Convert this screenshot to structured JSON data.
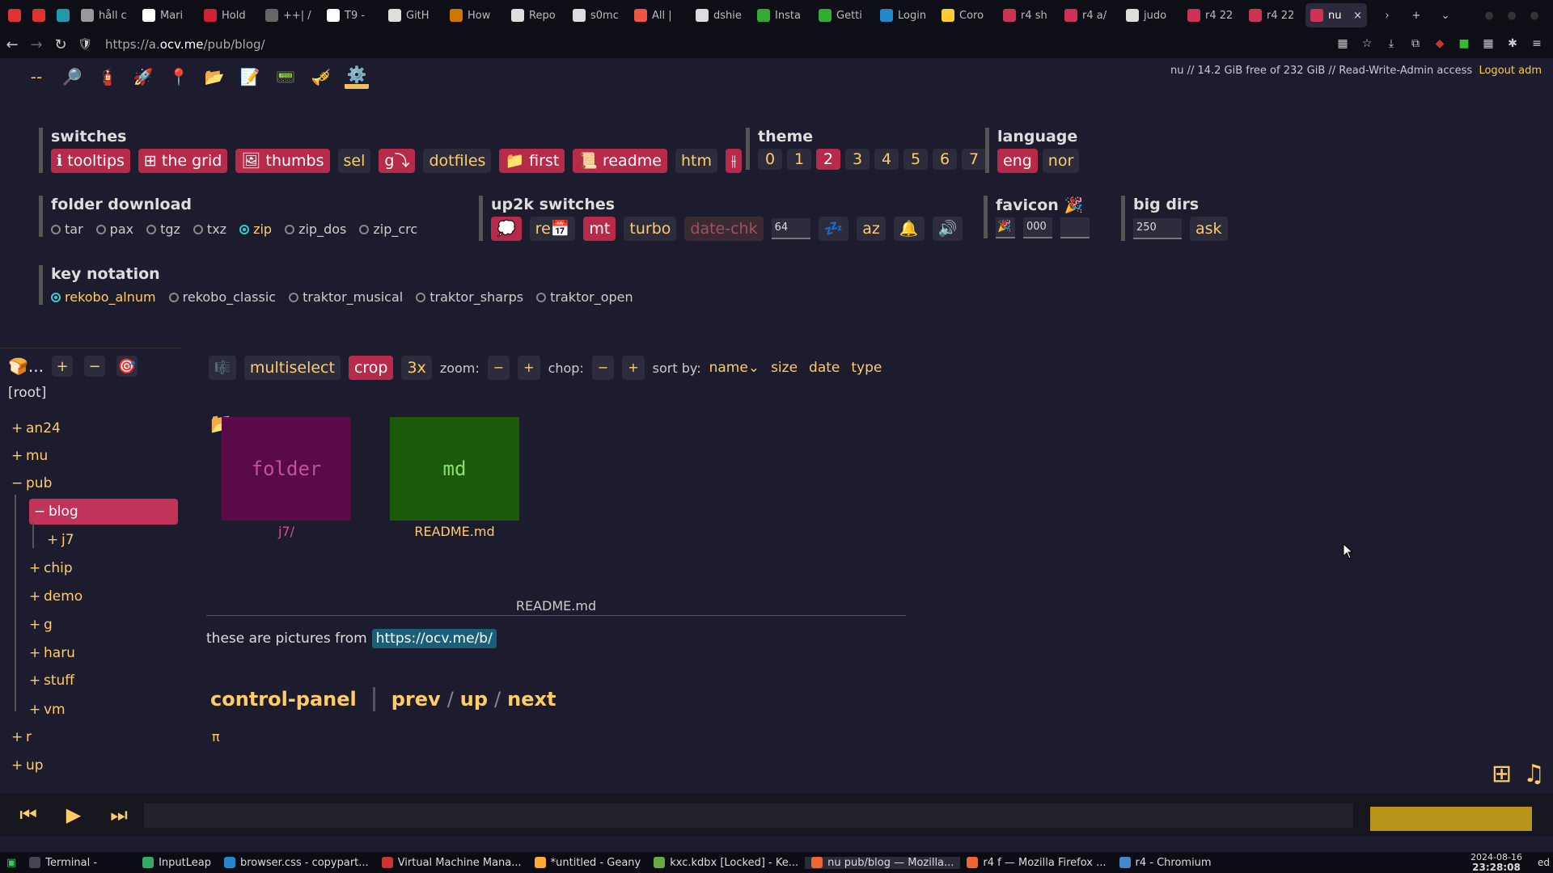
{
  "browser": {
    "tabs": [
      {
        "label": "",
        "icon": "opera-icon",
        "color": "#d33"
      },
      {
        "label": "",
        "icon": "opera-icon",
        "color": "#d33"
      },
      {
        "label": "",
        "icon": "telegram-icon",
        "color": "#29a"
      },
      {
        "label": "håll c",
        "icon": "back-chevron-icon",
        "color": "#999"
      },
      {
        "label": "Mari",
        "icon": "google-icon",
        "color": "#fff"
      },
      {
        "label": "Hold",
        "icon": "page-icon",
        "color": "#c23"
      },
      {
        "label": "++| /",
        "icon": "page-icon",
        "color": "#666"
      },
      {
        "label": "T9 -",
        "icon": "wikipedia-icon",
        "color": "#fff"
      },
      {
        "label": "GitH",
        "icon": "github-icon",
        "color": "#ddd"
      },
      {
        "label": "How",
        "icon": "page-icon",
        "color": "#c70"
      },
      {
        "label": "Repo",
        "icon": "github-icon",
        "color": "#ddd"
      },
      {
        "label": "s0mc",
        "icon": "github-icon",
        "color": "#ddd"
      },
      {
        "label": "All |",
        "icon": "page-icon",
        "color": "#e54"
      },
      {
        "label": "dshie",
        "icon": "github-icon",
        "color": "#ddd"
      },
      {
        "label": "Insta",
        "icon": "page-icon",
        "color": "#3a3"
      },
      {
        "label": "Getti",
        "icon": "page-icon",
        "color": "#3a3"
      },
      {
        "label": "Login",
        "icon": "page-icon",
        "color": "#28c"
      },
      {
        "label": "Coro",
        "icon": "python-icon",
        "color": "#fc3"
      },
      {
        "label": "r4 sh",
        "icon": "party-icon",
        "color": "#c35"
      },
      {
        "label": "r4 a/",
        "icon": "party-icon",
        "color": "#c35"
      },
      {
        "label": "judo",
        "icon": "github-icon",
        "color": "#ddd"
      },
      {
        "label": "r4 22",
        "icon": "party-icon",
        "color": "#c35"
      },
      {
        "label": "r4 22",
        "icon": "party-icon",
        "color": "#c35"
      },
      {
        "label": "nu",
        "icon": "party-icon",
        "color": "#c35",
        "active": true
      }
    ],
    "url_prefix": "https://a.",
    "url_host": "ocv.me",
    "url_path": "/pub/blog/"
  },
  "accent": "#c2335a",
  "gold": "#ffcc66",
  "topbar": {
    "account_info": "nu // 14.2 GiB free of 232 GiB  //  Read-Write-Admin access",
    "logout": "Logout adm"
  },
  "switches": {
    "title": "switches",
    "items": [
      {
        "label": "ℹ tooltips",
        "on": true
      },
      {
        "label": "⊞ the grid",
        "on": true
      },
      {
        "label": "🖼 thumbs",
        "on": true
      },
      {
        "label": "sel",
        "on": false
      },
      {
        "label": "g⤵",
        "on": true
      },
      {
        "label": "dotfiles",
        "on": false
      },
      {
        "label": "📁 first",
        "on": true
      },
      {
        "label": "📜 readme",
        "on": true
      },
      {
        "label": "htm",
        "on": false
      },
      {
        "label": "⫲",
        "on": true
      }
    ]
  },
  "theme": {
    "title": "theme",
    "options": [
      "0",
      "1",
      "2",
      "3",
      "4",
      "5",
      "6",
      "7"
    ],
    "selected": "2"
  },
  "language": {
    "title": "language",
    "options": [
      "eng",
      "nor"
    ],
    "selected": "eng"
  },
  "folder_download": {
    "title": "folder download",
    "options": [
      "tar",
      "pax",
      "tgz",
      "txz",
      "zip",
      "zip_dos",
      "zip_crc"
    ],
    "selected": "zip"
  },
  "up2k": {
    "title": "up2k switches",
    "items": [
      {
        "label": "💭",
        "on": true
      },
      {
        "label": "re📅",
        "on": false
      },
      {
        "label": "mt",
        "on": true
      },
      {
        "label": "turbo",
        "on": false
      },
      {
        "label": "date-chk",
        "on": false,
        "dim": true
      }
    ],
    "threads": "64",
    "extra": [
      "💤",
      "az",
      "🔔",
      "🔊"
    ]
  },
  "favicon": {
    "title": "favicon 🎉",
    "emoji": "🎉",
    "color": "000",
    "extra": ""
  },
  "bigdirs": {
    "title": "big dirs",
    "value": "250",
    "button": "ask"
  },
  "key_notation": {
    "title": "key notation",
    "options": [
      "rekobo_alnum",
      "rekobo_classic",
      "traktor_musical",
      "traktor_sharps",
      "traktor_open"
    ],
    "selected": "rekobo_alnum"
  },
  "tree": {
    "header_icon": "🍞...",
    "header_btns": [
      "+",
      "−"
    ],
    "root": "[root]",
    "nodes": [
      {
        "pm": "+",
        "label": "an24"
      },
      {
        "pm": "+",
        "label": "mu"
      },
      {
        "pm": "−",
        "label": "pub"
      },
      {
        "pm": "−",
        "label": "blog"
      },
      {
        "pm": "+",
        "label": "j7"
      },
      {
        "pm": "+",
        "label": "chip"
      },
      {
        "pm": "+",
        "label": "demo"
      },
      {
        "pm": "+",
        "label": "g"
      },
      {
        "pm": "+",
        "label": "haru"
      },
      {
        "pm": "+",
        "label": "stuff"
      },
      {
        "pm": "+",
        "label": "vm"
      },
      {
        "pm": "+",
        "label": "r"
      },
      {
        "pm": "+",
        "label": "up"
      }
    ]
  },
  "filebar": {
    "multiselect": "multiselect",
    "crop": "crop",
    "x3": "3x",
    "zoom": "zoom:",
    "chop": "chop:",
    "minus": "−",
    "plus": "+",
    "sortby": "sort by:",
    "sort_name": "name⌄",
    "sort_size": "size",
    "sort_date": "date",
    "sort_type": "type"
  },
  "files": [
    {
      "thumb": "folder",
      "name": "j7/",
      "bg": "#5a0a46",
      "fg": "#c050a0",
      "capcolor": "#d050a0"
    },
    {
      "thumb": "md",
      "name": "README.md",
      "bg": "#1a5a0a",
      "fg": "#8ce06c",
      "capcolor": "#fc6"
    }
  ],
  "readme": {
    "title": "README.md",
    "text": "these are pictures from",
    "link": "https://ocv.me/b/",
    "control_panel": "control-panel",
    "prev": "prev",
    "up": "up",
    "next": "next",
    "pi": "π"
  },
  "player": {
    "prev": "⏮",
    "play": "▶",
    "next": "⏭"
  },
  "taskbar": {
    "items": [
      {
        "label": "Terminal -",
        "color": "#445"
      },
      {
        "label": "InputLeap",
        "color": "#3a6"
      },
      {
        "label": "browser.css - copypart...",
        "color": "#28c"
      },
      {
        "label": "Virtual Machine Mana...",
        "color": "#c33"
      },
      {
        "label": "*untitled - Geany",
        "color": "#fa3"
      },
      {
        "label": "kxc.kdbx [Locked] - Ke...",
        "color": "#6a4"
      },
      {
        "label": "nu pub/blog — Mozilla...",
        "color": "#e63",
        "active": true
      },
      {
        "label": "r4 f — Mozilla Firefox ...",
        "color": "#e63"
      },
      {
        "label": "r4 - Chromium",
        "color": "#48c"
      }
    ],
    "date": "2024-08-16",
    "time": "23:28:08",
    "user": "ed"
  }
}
